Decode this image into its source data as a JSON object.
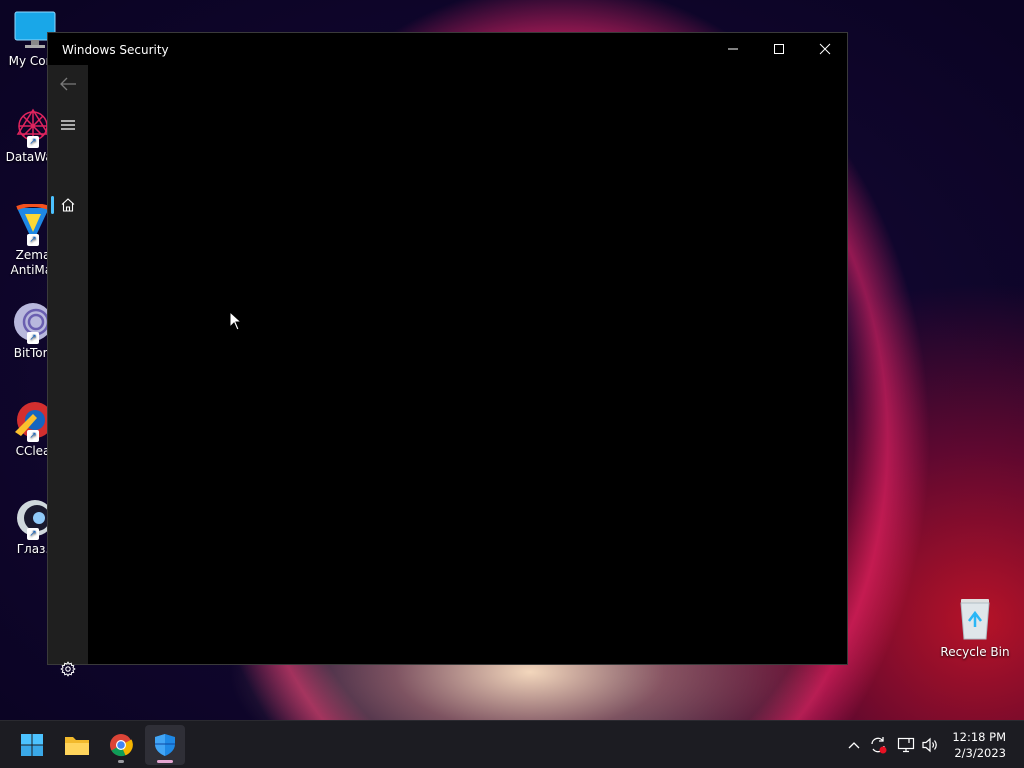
{
  "desktop": {
    "icons": [
      {
        "label": "My Com",
        "icon": "computer-monitor-icon"
      },
      {
        "label": "DataWag",
        "icon": "datawag-icon"
      },
      {
        "label": "Zema AntiMal",
        "icon": "zemana-icon"
      },
      {
        "label": "BitTorr",
        "icon": "bittorrent-icon"
      },
      {
        "label": "CClea",
        "icon": "ccleaner-icon"
      },
      {
        "label": "Глаз.",
        "icon": "eye-app-icon"
      }
    ],
    "recycle_bin": {
      "label": "Recycle Bin",
      "icon": "recycle-bin-icon"
    }
  },
  "window": {
    "title": "Windows Security",
    "controls": [
      "minimize",
      "maximize",
      "close"
    ],
    "nav": {
      "items": [
        {
          "name": "back",
          "icon": "back-arrow-icon"
        },
        {
          "name": "menu",
          "icon": "hamburger-icon"
        },
        {
          "name": "home",
          "icon": "home-icon",
          "active": true
        },
        {
          "name": "settings",
          "icon": "gear-icon"
        }
      ]
    }
  },
  "taskbar": {
    "apps": [
      {
        "name": "start",
        "icon": "windows-logo-icon"
      },
      {
        "name": "file-explorer",
        "icon": "folder-icon"
      },
      {
        "name": "chrome",
        "icon": "chrome-icon"
      },
      {
        "name": "windows-security",
        "icon": "shield-icon",
        "active": true
      }
    ],
    "tray": [
      "chevron-up-icon",
      "sync-icon",
      "network-icon",
      "volume-icon"
    ],
    "clock": {
      "time": "12:18 PM",
      "date": "2/3/2023"
    }
  },
  "colors": {
    "accent": "#4cc2ff",
    "window_bg": "#000000",
    "nav_bg": "#1f1f1f",
    "taskbar_bg": "#1c1c22"
  }
}
